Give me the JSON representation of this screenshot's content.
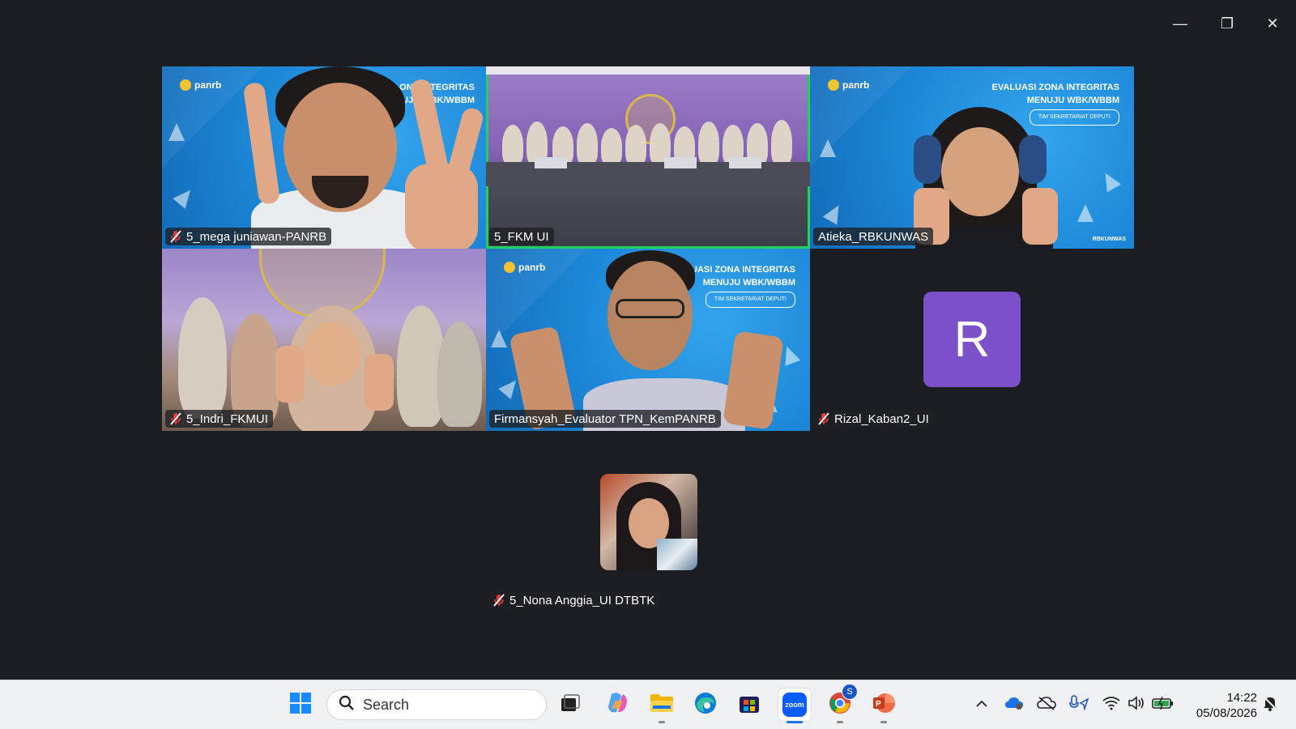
{
  "window": {
    "minimize_glyph": "—",
    "restore_glyph": "❐",
    "close_glyph": "✕"
  },
  "branding": {
    "logo_text": "panrb",
    "banner_line1": "EVALUASI ZONA INTEGRITAS",
    "banner_line2": "MENUJU WBK/WBBM",
    "banner_sub": "TIM SEKRETARIAT DEPUTI",
    "banner_partial_line1": "LUASI ZONA INTEGRITAS",
    "banner_partial_line2": "MENUJU WBK/WBBM",
    "t1_partial_line1": "ONA INTEGRITAS",
    "t1_partial_line2": "UJU WBK/WBBM",
    "t3_corner": "RBKUNWAS"
  },
  "participants": [
    {
      "name": "5_mega juniawan-PANRB",
      "muted": true
    },
    {
      "name": "5_FKM UI",
      "muted": false,
      "active_speaker": true
    },
    {
      "name": "Atieka_RBKUNWAS",
      "muted": false
    },
    {
      "name": "5_Indri_FKMUI",
      "muted": true
    },
    {
      "name": "Firmansyah_Evaluator TPN_KemPANRB",
      "muted": false
    },
    {
      "name": "Rizal_Kaban2_UI",
      "muted": true,
      "avatar_letter": "R"
    },
    {
      "name": "5_Nona Anggia_UI DTBTK",
      "muted": true
    }
  ],
  "colors": {
    "active_speaker_border": "#23d160",
    "avatar_bg": "#7b50c9",
    "mute_red": "#e8383d"
  },
  "taskbar": {
    "search_placeholder": "Search",
    "apps": [
      "start-icon",
      "task-view-icon",
      "copilot-icon",
      "file-explorer-icon",
      "edge-icon",
      "store-icon",
      "zoom-icon",
      "chrome-icon",
      "powerpoint-icon"
    ],
    "zoom_label": "zoom",
    "chrome_badge": "S",
    "time": "14:22",
    "date": "05/08/2026"
  }
}
